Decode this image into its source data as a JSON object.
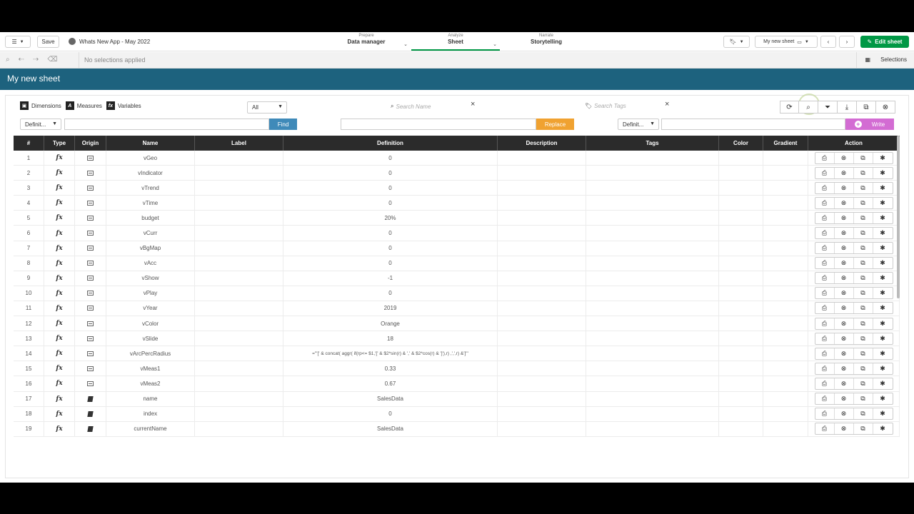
{
  "topbar": {
    "save_label": "Save",
    "app_title": "Whats New App - May 2022",
    "nav": [
      {
        "small": "Prepare",
        "big": "Data manager"
      },
      {
        "small": "Analyze",
        "big": "Sheet"
      },
      {
        "small": "Narrate",
        "big": "Storytelling"
      }
    ],
    "sheet_selector": "My new sheet",
    "edit_label": "Edit sheet"
  },
  "selbar": {
    "no_selections": "No selections applied",
    "selections_label": "Selections"
  },
  "sheet": {
    "title": "My new sheet"
  },
  "panel": {
    "tabs": [
      "Dimensions",
      "Measures",
      "Variables"
    ],
    "filter_all": "All",
    "search_name_placeholder": "Search Name",
    "search_tags_placeholder": "Search Tags",
    "definition_select_1": "Definit...",
    "definition_select_2": "Definit...",
    "find_label": "Find",
    "replace_label": "Replace",
    "write_label": "Write"
  },
  "table": {
    "headers": [
      "#",
      "Type",
      "Origin",
      "Name",
      "Label",
      "Definition",
      "Description",
      "Tags",
      "Color",
      "Gradient",
      "Action"
    ],
    "rows": [
      {
        "num": "1",
        "origin": "table",
        "name": "vGeo",
        "def": "0"
      },
      {
        "num": "2",
        "origin": "table",
        "name": "vIndicator",
        "def": "0"
      },
      {
        "num": "3",
        "origin": "table",
        "name": "vTrend",
        "def": "0"
      },
      {
        "num": "4",
        "origin": "table",
        "name": "vTime",
        "def": "0"
      },
      {
        "num": "5",
        "origin": "table",
        "name": "budget",
        "def": "20%"
      },
      {
        "num": "6",
        "origin": "table",
        "name": "vCurr",
        "def": "0"
      },
      {
        "num": "7",
        "origin": "table",
        "name": "vBgMap",
        "def": "0"
      },
      {
        "num": "8",
        "origin": "table",
        "name": "vAcc",
        "def": "0"
      },
      {
        "num": "9",
        "origin": "table",
        "name": "vShow",
        "def": "-1"
      },
      {
        "num": "10",
        "origin": "table",
        "name": "vPlay",
        "def": "0"
      },
      {
        "num": "11",
        "origin": "table",
        "name": "vYear",
        "def": "2019"
      },
      {
        "num": "12",
        "origin": "table",
        "name": "vColor",
        "def": "Orange"
      },
      {
        "num": "13",
        "origin": "table",
        "name": "vSlide",
        "def": "18"
      },
      {
        "num": "14",
        "origin": "table",
        "name": "vArcPercRadius",
        "def": "='\"[' & concat( aggr( if(rp<= $1,'[' & $2*sin(r) & ',' & $2*cos(r) & ']'),r) ,',',r) &']\"'"
      },
      {
        "num": "15",
        "origin": "table",
        "name": "vMeas1",
        "def": "0.33"
      },
      {
        "num": "16",
        "origin": "table",
        "name": "vMeas2",
        "def": "0.67"
      },
      {
        "num": "17",
        "origin": "script",
        "name": "name",
        "def": "SalesData"
      },
      {
        "num": "18",
        "origin": "script",
        "name": "index",
        "def": "0"
      },
      {
        "num": "19",
        "origin": "script",
        "name": "currentName",
        "def": "SalesData"
      }
    ]
  },
  "colors": {
    "sheet_bar": "#1d627e",
    "edit": "#009845",
    "find": "#3f8ab9",
    "replace": "#f0a231",
    "write": "#d36cd3"
  }
}
